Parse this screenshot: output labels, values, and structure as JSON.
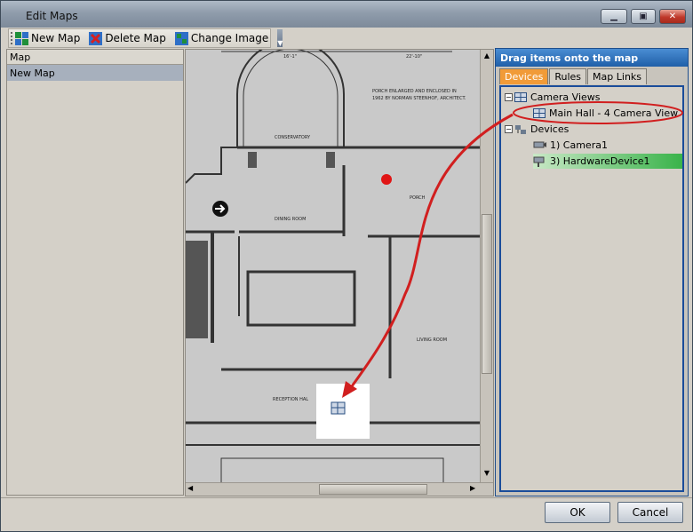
{
  "window": {
    "title": "Edit Maps"
  },
  "toolbar": {
    "new_map_label": "New Map",
    "delete_map_label": "Delete Map",
    "change_image_label": "Change Image"
  },
  "left_panel": {
    "header": "Map",
    "items": [
      {
        "label": "New Map"
      }
    ]
  },
  "map": {
    "labels": {
      "conservatory": "CONSERVATORY",
      "dining_room": "DINING ROOM",
      "living_room": "LIVING ROOM",
      "reception": "RECEPTION  HAL",
      "porch": "PORCH",
      "note_line1": "PORCH ENLARGED AND ENCLOSED IN",
      "note_line2": "1962 BY NORMAN STEENHOF, ARCHITECT.",
      "dim1": "16'-1\"",
      "dim2": "22'-10\""
    }
  },
  "right_panel": {
    "header": "Drag items onto the map",
    "tabs": [
      "Devices",
      "Rules",
      "Map Links"
    ],
    "tree": {
      "camera_views_label": "Camera Views",
      "camera_view_item": "Main Hall - 4 Camera View",
      "devices_label": "Devices",
      "device_items": [
        "1) Camera1",
        "3) HardwareDevice1"
      ]
    }
  },
  "footer": {
    "ok_label": "OK",
    "cancel_label": "Cancel"
  },
  "colors": {
    "accent_tab": "#f19b38",
    "panel_header": "#1f5fa8",
    "annotation": "#d11f1f",
    "selected_row": "#a7b0bd"
  }
}
